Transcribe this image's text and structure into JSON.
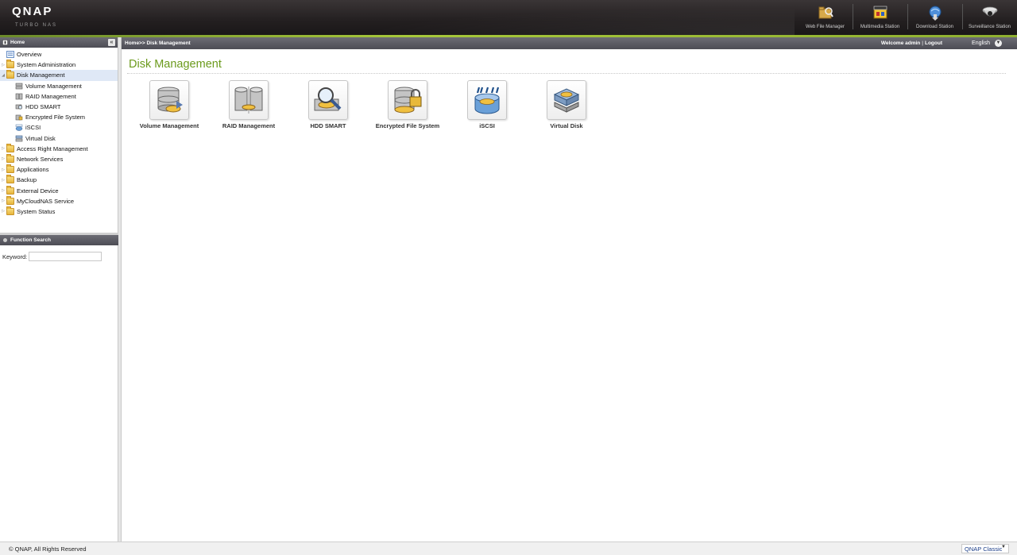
{
  "header": {
    "logo": "QNAP",
    "logo_sub": "TURBO NAS",
    "apps": [
      {
        "label": "Web File Manager",
        "icon": "web-file-manager-icon"
      },
      {
        "label": "Multimedia Station",
        "icon": "multimedia-station-icon"
      },
      {
        "label": "Download Station",
        "icon": "download-station-icon"
      },
      {
        "label": "Surveillance Station",
        "icon": "surveillance-station-icon"
      }
    ]
  },
  "sidebar": {
    "title": "Home",
    "collapse": "«",
    "items": [
      {
        "label": "Overview"
      },
      {
        "label": "System Administration"
      },
      {
        "label": "Disk Management"
      },
      {
        "label": "Volume Management"
      },
      {
        "label": "RAID Management"
      },
      {
        "label": "HDD SMART"
      },
      {
        "label": "Encrypted File System"
      },
      {
        "label": "iSCSI"
      },
      {
        "label": "Virtual Disk"
      },
      {
        "label": "Access Right Management"
      },
      {
        "label": "Network Services"
      },
      {
        "label": "Applications"
      },
      {
        "label": "Backup"
      },
      {
        "label": "External Device"
      },
      {
        "label": "MyCloudNAS Service"
      },
      {
        "label": "System Status"
      }
    ]
  },
  "search": {
    "title": "Function Search",
    "keyword_label": "Keyword:",
    "keyword_value": ""
  },
  "topbar": {
    "breadcrumb": "Home>> Disk Management",
    "welcome": "Welcome admin",
    "separator": "|",
    "logout": "Logout",
    "language": "English"
  },
  "main": {
    "title": "Disk Management",
    "tiles": [
      {
        "label": "Volume Management"
      },
      {
        "label": "RAID Management"
      },
      {
        "label": "HDD SMART"
      },
      {
        "label": "Encrypted File System"
      },
      {
        "label": "iSCSI"
      },
      {
        "label": "Virtual Disk"
      }
    ]
  },
  "footer": {
    "copyright": "© QNAP, All Rights Reserved",
    "theme": "QNAP Classic"
  },
  "colors": {
    "accent_green": "#6b9a1c",
    "header_dark": "#231f20",
    "selected_row": "#dfe8f6"
  }
}
